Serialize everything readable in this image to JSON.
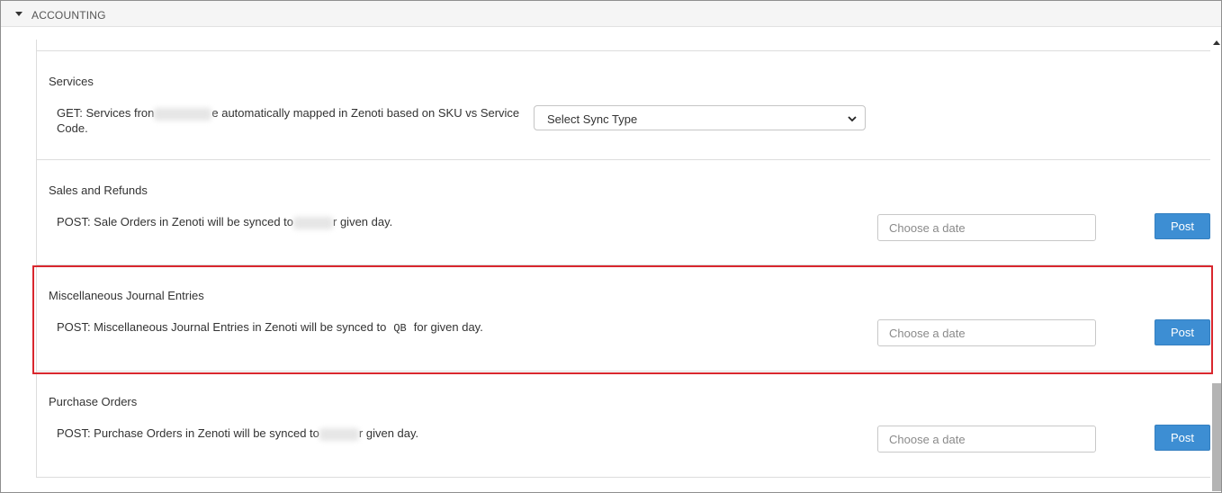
{
  "header": {
    "title": "ACCOUNTING"
  },
  "sections": [
    {
      "title": "Services",
      "desc_line1_a": "GET: Services fron",
      "desc_line1_b": "e automatically mapped in Zenoti based on SKU vs Service",
      "desc_line2": "Code.",
      "select_value": "Select Sync Type"
    },
    {
      "title": "Sales and Refunds",
      "desc_a": "POST: Sale Orders in Zenoti will be synced to",
      "desc_b": "r given day.",
      "date_placeholder": "Choose a date",
      "button": "Post"
    },
    {
      "title": "Miscellaneous Journal Entries",
      "desc_a": "POST: Miscellaneous Journal Entries in Zenoti will be synced to",
      "desc_code": "QB",
      "desc_b": "for given day.",
      "date_placeholder": "Choose a date",
      "button": "Post"
    },
    {
      "title": "Purchase Orders",
      "desc_a": "POST: Purchase Orders in Zenoti will be synced to",
      "desc_b": "r given day.",
      "date_placeholder": "Choose a date",
      "button": "Post"
    }
  ],
  "colors": {
    "accent": "#3d8ed3",
    "highlight": "#d9272e"
  },
  "icons": {
    "collapse": "caret-down-icon",
    "select": "chevron-down-icon",
    "scroll": "scroll-up-icon"
  }
}
